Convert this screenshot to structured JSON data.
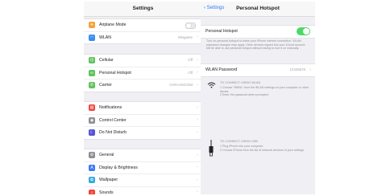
{
  "settings": {
    "title": "Settings",
    "group1": [
      {
        "label": "Airplane Mode",
        "value": "",
        "icon": "airplane-icon",
        "glyph": "✈",
        "color": "#f7a23b",
        "control": "toggle"
      },
      {
        "label": "WLAN",
        "value": "Mingame",
        "icon": "wifi-icon",
        "glyph": "◠",
        "color": "#3a8df5",
        "control": "chevron"
      }
    ],
    "group2": [
      {
        "label": "Cellular",
        "value": "Off",
        "icon": "cellular-icon",
        "glyph": "⌬",
        "color": "#5ec55e"
      },
      {
        "label": "Personal Hotspot",
        "value": "Off",
        "icon": "hotspot-icon",
        "glyph": "∞",
        "color": "#5ec55e"
      },
      {
        "label": "Carrier",
        "value": "CHN-UNICOM",
        "icon": "phone-icon",
        "glyph": "✆",
        "color": "#5ec55e"
      }
    ],
    "group3": [
      {
        "label": "Notifications",
        "icon": "notifications-icon",
        "glyph": "▤",
        "color": "#f0463a"
      },
      {
        "label": "Control Center",
        "icon": "control-center-icon",
        "glyph": "◉",
        "color": "#8e8e93"
      },
      {
        "label": "Do Not Disturb",
        "icon": "moon-icon",
        "glyph": "☾",
        "color": "#5856d6"
      }
    ],
    "group4": [
      {
        "label": "General",
        "icon": "gear-icon",
        "glyph": "⚙",
        "color": "#8e8e93"
      },
      {
        "label": "Display & Brightness",
        "icon": "display-icon",
        "glyph": "A",
        "color": "#3a7bf5"
      },
      {
        "label": "Wallpaper",
        "icon": "wallpaper-icon",
        "glyph": "✿",
        "color": "#36aadc"
      },
      {
        "label": "Sounds",
        "icon": "sounds-icon",
        "glyph": "♪",
        "color": "#f0463a"
      }
    ]
  },
  "hotspot": {
    "back_label": "Settings",
    "title": "Personal Hotspot",
    "toggle_label": "Personal Hotspot",
    "toggle_on": true,
    "description": "Turn on personal hotspot to share your iPhone internet connection. WLAN password changes may apply. Other devices signed into your iCloud account will be able to use personal hotspot without having to turn it on manually.",
    "password_label": "WLAN Password",
    "password_value": "12345678",
    "wifi_heading": "TO CONNECT USING WLAN",
    "wifi_steps": "1 Choose \"iBIKiA\" from the WLAN settings on your computer or other device.\n2 Enter the password when prompted.",
    "usb_heading": "TO CONNECT USING USB",
    "usb_steps": "1 Plug iPhone into your computer.\n2 Choose iPhone from the list of network services in your settings."
  }
}
